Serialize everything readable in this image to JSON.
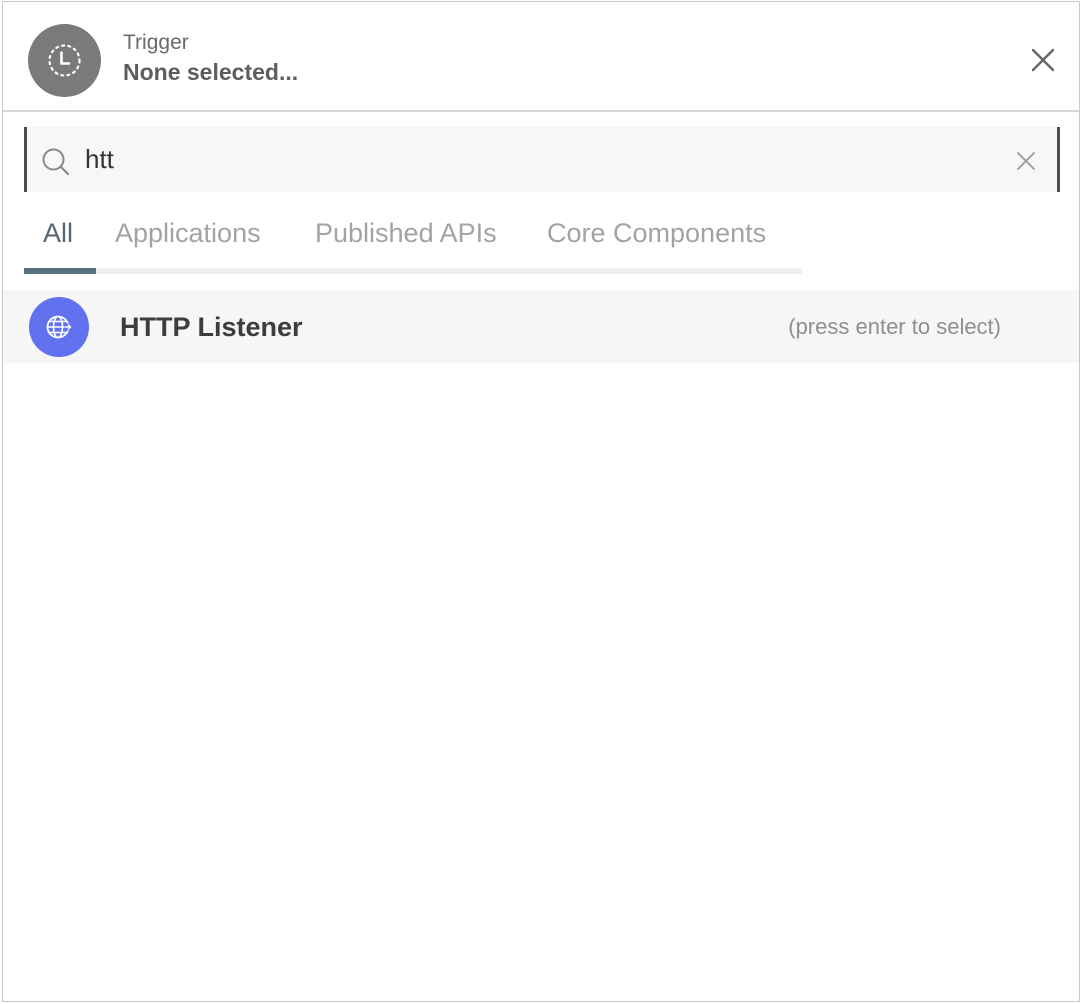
{
  "header": {
    "trigger_label": "Trigger",
    "trigger_value": "None selected...",
    "trigger_icon": "clock-icon",
    "close_icon": "close-icon"
  },
  "search": {
    "value": "htt",
    "placeholder": "",
    "search_icon": "search-icon",
    "clear_icon": "clear-icon"
  },
  "tabs": [
    {
      "label": "All",
      "active": true
    },
    {
      "label": "Applications",
      "active": false
    },
    {
      "label": "Published APIs",
      "active": false
    },
    {
      "label": "Core Components",
      "active": false
    }
  ],
  "results": [
    {
      "name": "HTTP Listener",
      "hint": "(press enter to select)",
      "icon": "globe-icon",
      "icon_color": "#6271ee"
    }
  ],
  "colors": {
    "accent": "#56707e",
    "result_icon_bg": "#6271ee",
    "trigger_icon_bg": "#7a7a7a"
  }
}
